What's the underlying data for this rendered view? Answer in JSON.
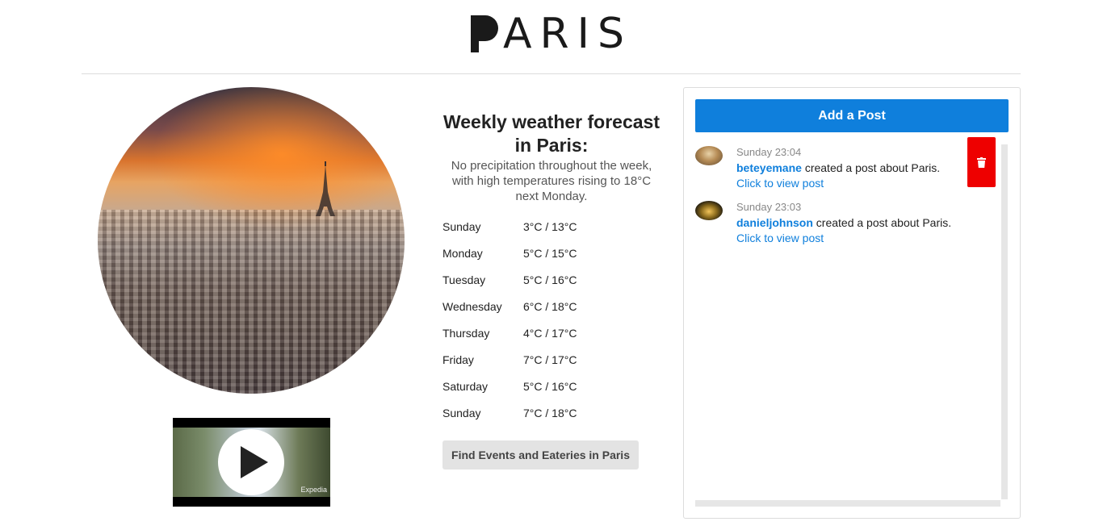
{
  "header": {
    "logo_text": "ARIS",
    "logo_mark_icon": "p-letter-mark-icon"
  },
  "hero": {
    "image_icon": "paris-skyline-photo"
  },
  "video": {
    "play_icon": "play-icon",
    "watermark": "Expedia"
  },
  "weather": {
    "title": "Weekly weather forecast in Paris:",
    "summary": "No precipitation throughout the week, with high temperatures rising to 18°C next Monday.",
    "forecast": [
      {
        "day": "Sunday",
        "temp": "3°C / 13°C"
      },
      {
        "day": "Monday",
        "temp": "5°C / 15°C"
      },
      {
        "day": "Tuesday",
        "temp": "5°C / 16°C"
      },
      {
        "day": "Wednesday",
        "temp": "6°C / 18°C"
      },
      {
        "day": "Thursday",
        "temp": "4°C / 17°C"
      },
      {
        "day": "Friday",
        "temp": "7°C / 17°C"
      },
      {
        "day": "Saturday",
        "temp": "5°C / 16°C"
      },
      {
        "day": "Sunday",
        "temp": "7°C / 18°C"
      }
    ],
    "find_button": "Find Events and Eateries in Paris"
  },
  "feed": {
    "add_post_label": "Add a Post",
    "posts": [
      {
        "time": "Sunday 23:04",
        "user": "beteyemane",
        "text": " created a post about Paris.",
        "link": "Click to view post"
      },
      {
        "time": "Sunday 23:03",
        "user": "danieljohnson",
        "text": " created a post about Paris.",
        "link": "Click to view post"
      }
    ],
    "delete_icon": "trash-icon"
  },
  "colors": {
    "accent": "#0f7fdc",
    "danger": "#ee0000",
    "button_gray": "#e3e3e3"
  }
}
